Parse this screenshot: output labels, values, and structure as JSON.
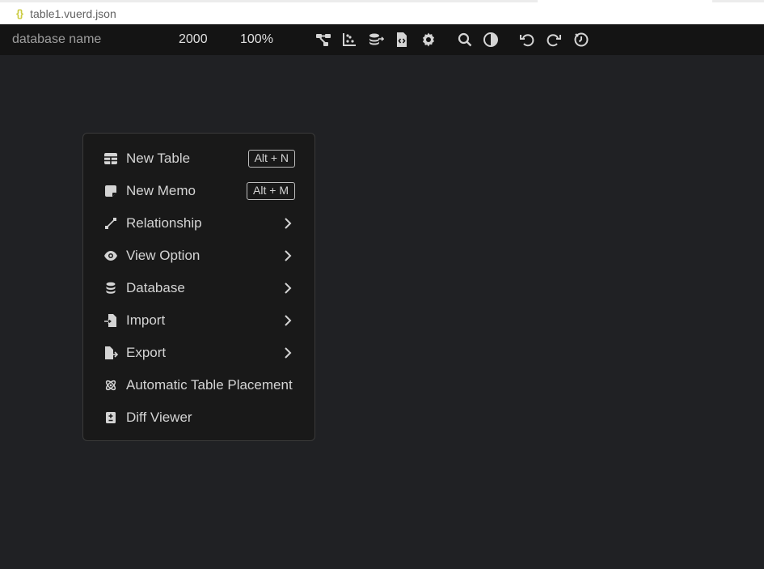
{
  "tab": {
    "filename": "table1.vuerd.json",
    "icon_glyph": "{}"
  },
  "toolbar": {
    "database_name": "database name",
    "canvas_size": "2000",
    "zoom": "100%",
    "icons": [
      "relationship-diagram-icon",
      "scatter-chart-icon",
      "database-import-icon",
      "code-file-icon",
      "gear-icon",
      "search-icon",
      "contrast-icon",
      "undo-icon",
      "redo-icon",
      "history-icon"
    ]
  },
  "menu": {
    "items": [
      {
        "label": "New Table",
        "shortcut": "Alt + N",
        "icon": "table-icon"
      },
      {
        "label": "New Memo",
        "shortcut": "Alt + M",
        "icon": "memo-icon"
      },
      {
        "label": "Relationship",
        "icon": "relationship-icon",
        "submenu": true
      },
      {
        "label": "View Option",
        "icon": "eye-icon",
        "submenu": true
      },
      {
        "label": "Database",
        "icon": "database-icon",
        "submenu": true
      },
      {
        "label": "Import",
        "icon": "import-icon",
        "submenu": true
      },
      {
        "label": "Export",
        "icon": "export-icon",
        "submenu": true
      },
      {
        "label": "Automatic Table Placement",
        "icon": "atom-icon"
      },
      {
        "label": "Diff Viewer",
        "icon": "diff-icon"
      }
    ]
  },
  "colors": {
    "canvas_bg": "#202124",
    "toolbar_bg": "#141414",
    "menu_bg": "#191919",
    "text": "#d4d4d4",
    "json_icon": "#cbcb41"
  }
}
